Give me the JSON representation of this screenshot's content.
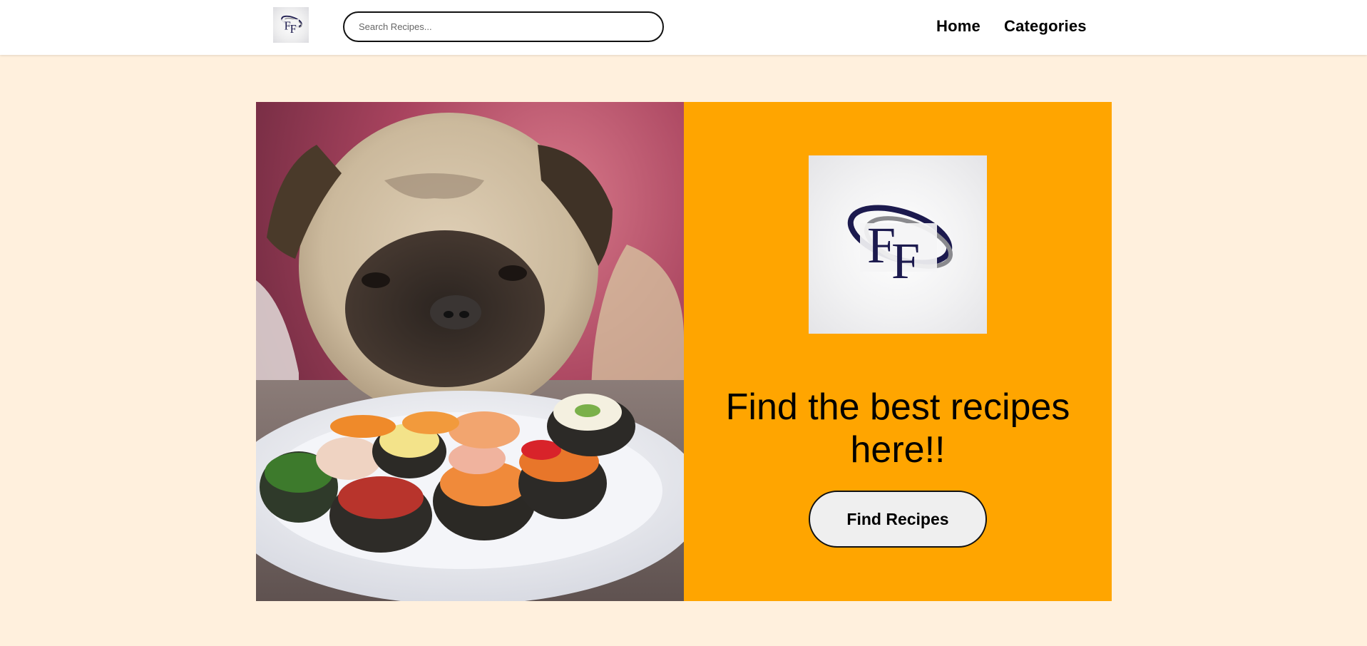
{
  "navbar": {
    "logo_text": "FF",
    "search": {
      "placeholder": "Search Recipes...",
      "value": ""
    },
    "links": [
      {
        "label": "Home"
      },
      {
        "label": "Categories"
      }
    ]
  },
  "hero": {
    "image_subject": "pug looking at a plate of sushi",
    "logo_text": "FF",
    "heading": "Find the best recipes here!!",
    "button_label": "Find Recipes"
  },
  "colors": {
    "page_background": "#fff0dd",
    "navbar_background": "#ffffff",
    "hero_panel": "#ffa500",
    "button_background": "#efefef",
    "logo_navy": "#1c1a4e",
    "logo_gray": "#8a8a8e"
  }
}
